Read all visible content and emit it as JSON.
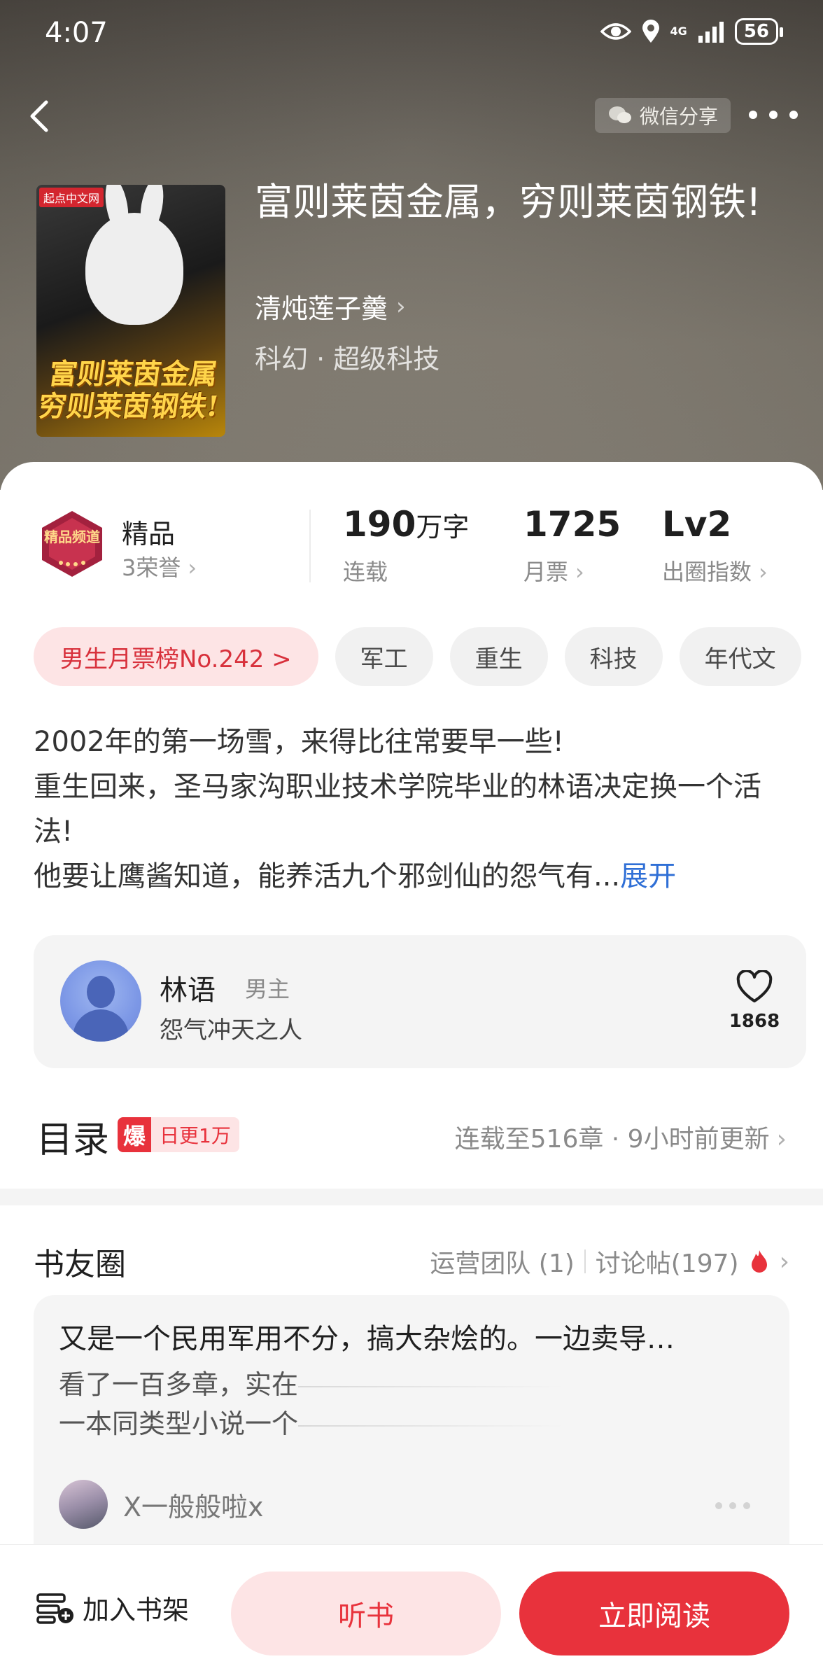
{
  "status_bar": {
    "time": "4:07",
    "network": "4G",
    "battery": "56",
    "icons": [
      "eye-icon",
      "location-icon",
      "signal-icon",
      "battery-icon"
    ]
  },
  "top_nav": {
    "share_label": "微信分享",
    "icons": [
      "back-arrow-icon",
      "wechat-icon",
      "more-icon"
    ]
  },
  "book": {
    "cover_publisher": "起点中文网",
    "cover_title_art": "富则莱茵金属 穷则莱茵钢铁!",
    "title": "富则莱茵金属，穷则莱茵钢铁!",
    "author": "清炖莲子羹",
    "genre": "科幻 · 超级科技"
  },
  "stats": {
    "badge": {
      "title": "精品",
      "subtitle": "3荣誉",
      "art_text": "精品频道"
    },
    "words": {
      "value": "190",
      "unit": "万字",
      "label": "连载"
    },
    "tickets": {
      "value": "1725",
      "label": "月票"
    },
    "level": {
      "value": "Lv2",
      "label": "出圈指数"
    }
  },
  "tags": [
    {
      "label": "男生月票榜No.242 >",
      "type": "rank"
    },
    {
      "label": "军工",
      "type": "normal"
    },
    {
      "label": "重生",
      "type": "normal"
    },
    {
      "label": "科技",
      "type": "normal"
    },
    {
      "label": "年代文",
      "type": "normal"
    }
  ],
  "description": {
    "line1": "2002年的第一场雪，来得比往常要早一些!",
    "line2": "重生回来，圣马家沟职业技术学院毕业的林语决定换一个活法!",
    "line3": "他要让鹰酱知道，能养活九个邪剑仙的怨气有...",
    "expand": "展开"
  },
  "character": {
    "name": "林语",
    "role": "男主",
    "desc": "怨气冲天之人",
    "likes": "1868"
  },
  "toc": {
    "title": "目录",
    "badge_icon": "爆",
    "badge_text": "日更1万",
    "info": "连载至516章 · 9小时前更新"
  },
  "circle": {
    "title": "书友圈",
    "team": "运营团队 (1)",
    "posts": "讨论帖(197)"
  },
  "post": {
    "title": "又是一个民用军用不分，搞大杂烩的。一边卖导…",
    "line1": "看了一百多章，实在",
    "line2": "一本同类型小说一个",
    "username": "X一般般啦x"
  },
  "bottom_bar": {
    "shelf": "加入书架",
    "listen": "听书",
    "read": "立即阅读"
  },
  "colors": {
    "accent": "#e8323c",
    "accent_light": "#fde4e5",
    "link": "#2f6fd6"
  }
}
